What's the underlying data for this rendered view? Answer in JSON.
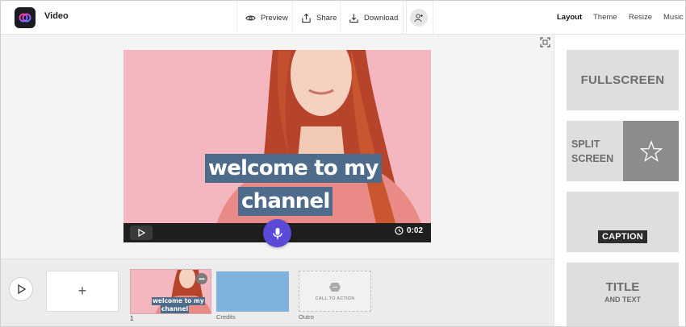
{
  "app": {
    "title": "Video"
  },
  "toolbar": {
    "preview_label": "Preview",
    "share_label": "Share",
    "download_label": "Download"
  },
  "tabs": [
    {
      "label": "Layout",
      "active": true
    },
    {
      "label": "Theme",
      "active": false
    },
    {
      "label": "Resize",
      "active": false
    },
    {
      "label": "Music",
      "active": false
    }
  ],
  "player": {
    "caption_line1": "welcome to my",
    "caption_line2": "channel",
    "duration": "0:02"
  },
  "timeline": {
    "add_label": "+",
    "clips": [
      {
        "number": "1",
        "caption_line1": "welcome to my",
        "caption_line2": "channel"
      },
      {
        "label": "Credits"
      },
      {
        "label": "Outro",
        "placeholder": "CALL TO ACTION"
      }
    ]
  },
  "layouts": {
    "fullscreen": "FULLSCREEN",
    "split_line1": "SPLIT",
    "split_line2": "SCREEN",
    "caption": "CAPTION",
    "title_line1": "TITLE",
    "title_line2": "AND TEXT"
  },
  "colors": {
    "accent": "#5b4ad8",
    "caption_bg": "#4f6b8c",
    "credits_clip": "#7fb2dc"
  }
}
